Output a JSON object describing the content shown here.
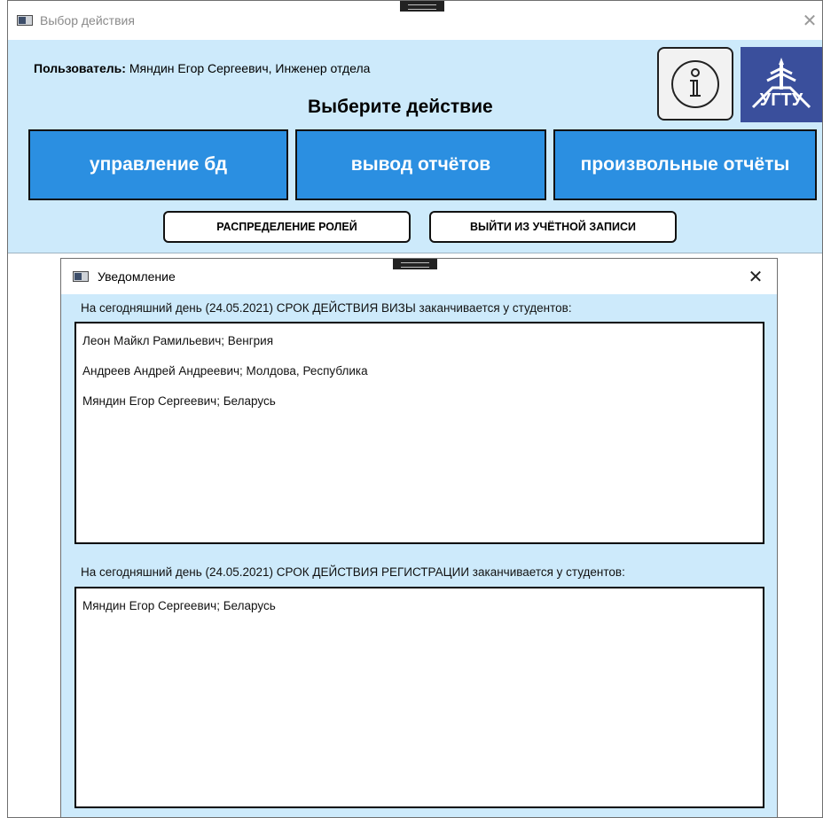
{
  "main_window": {
    "title": "Выбор действия",
    "close_glyph": "✕",
    "user_label": "Пользователь:",
    "user_value": "Мяндин Егор Сергеевич, Инженер отдела",
    "heading": "Выберите действие",
    "buttons": {
      "db": "управление бд",
      "reports": "вывод отчётов",
      "custom_reports": "произвольные отчёты",
      "roles": "РАСПРЕДЕЛЕНИЕ РОЛЕЙ",
      "logout": "ВЫЙТИ ИЗ УЧЁТНОЙ ЗАПИСИ"
    },
    "info_icon": "info-icon",
    "logo_text": "УГТУ",
    "logo_color": "#3a4f9c"
  },
  "notification": {
    "title": "Уведомление",
    "close_glyph": "✕",
    "visa_label": "На сегодняшний день (24.05.2021) СРОК ДЕЙСТВИЯ ВИЗЫ заканчивается у студентов:",
    "visa_items": [
      "Леон Майкл Рамильевич; Венгрия",
      "Андреев Андрей Андреевич; Молдова, Республика",
      "Мяндин Егор Сергеевич; Беларусь"
    ],
    "registration_label": "На сегодняшний день (24.05.2021) СРОК ДЕЙСТВИЯ РЕГИСТРАЦИИ заканчивается у студентов:",
    "registration_items": [
      "Мяндин Егор Сергеевич; Беларусь"
    ]
  },
  "colors": {
    "panel_bg": "#cdeafb",
    "button_blue": "#2b8fe1"
  }
}
